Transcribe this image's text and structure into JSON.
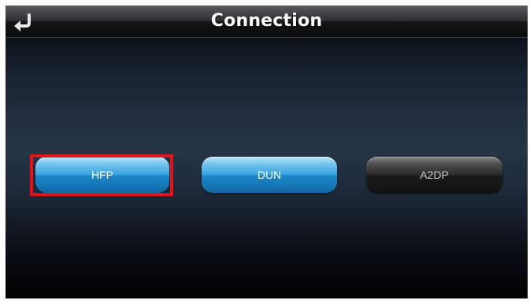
{
  "header": {
    "title": "Connection",
    "back_icon": "return-arrow-icon"
  },
  "buttons": [
    {
      "label": "HFP",
      "state": "selected"
    },
    {
      "label": "DUN",
      "state": "enabled"
    },
    {
      "label": "A2DP",
      "state": "disabled"
    }
  ],
  "colors": {
    "accent_blue": "#35a2df",
    "selection_red": "#e0141b",
    "disabled_gray": "#2a2a2a"
  }
}
